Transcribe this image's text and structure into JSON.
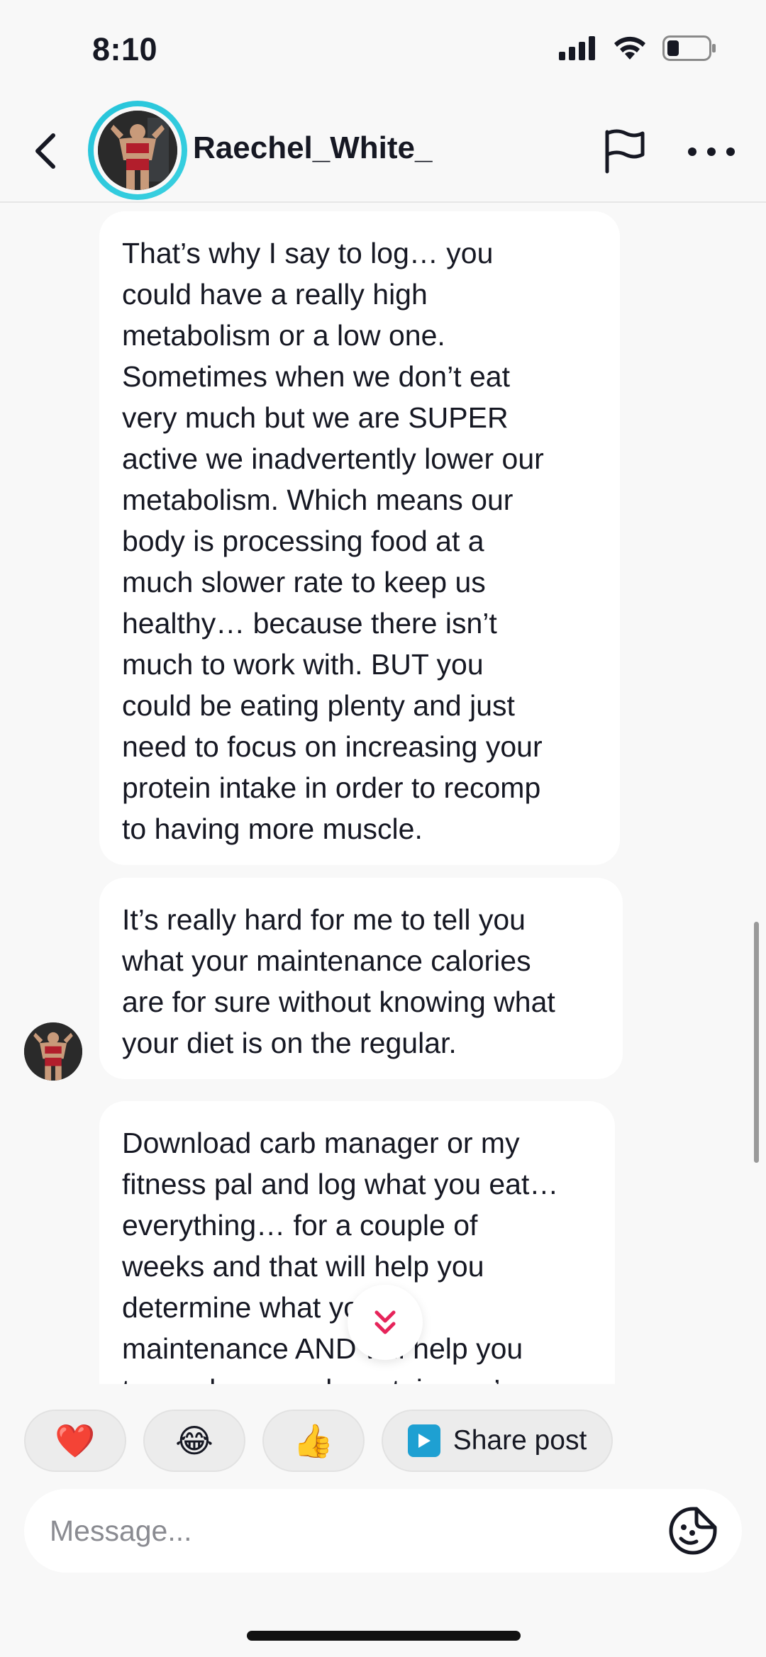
{
  "status_bar": {
    "time": "8:10"
  },
  "header": {
    "username": "Raechel_White_"
  },
  "messages": [
    {
      "sender": "Raechel_White_",
      "text": "That’s why I say to log… you\ncould have a really high\nmetabolism or a low one.\nSometimes when we don’t eat\nvery much but we are SUPER\nactive we inadvertently lower our\nmetabolism. Which means our\nbody is processing food at a\nmuch slower rate to keep us\nhealthy… because there isn’t\nmuch to work with. BUT you\ncould be eating plenty and just\nneed to focus on increasing your\nprotein intake in order to recomp\nto having more muscle."
    },
    {
      "sender": "Raechel_White_",
      "text": "It’s really hard for me to tell you\nwhat your maintenance calories\nare for sure without knowing what\nyour diet is on the regular."
    },
    {
      "sender": "Raechel_White_",
      "text": "Download carb manager or my\nfitness pal and log what you eat…\neverything… for a couple of\nweeks and that will help you\ndetermine what your\nmaintenance AND will help you\nto see how much protein you’re"
    }
  ],
  "quick_replies": [
    {
      "emoji": "❤️",
      "icon": "heart-emoji"
    },
    {
      "emoji": "😂",
      "icon": "tears-of-joy-emoji"
    },
    {
      "emoji": "👍",
      "icon": "thumbs-up-emoji"
    }
  ],
  "share_post": {
    "label": "Share post",
    "icon": "play-icon",
    "color": "#1ea0d2"
  },
  "composer": {
    "placeholder": "Message..."
  },
  "colors": {
    "avatar_ring": "#25c4da",
    "jump_arrow": "#e6245a",
    "background": "#f8f8f8"
  }
}
